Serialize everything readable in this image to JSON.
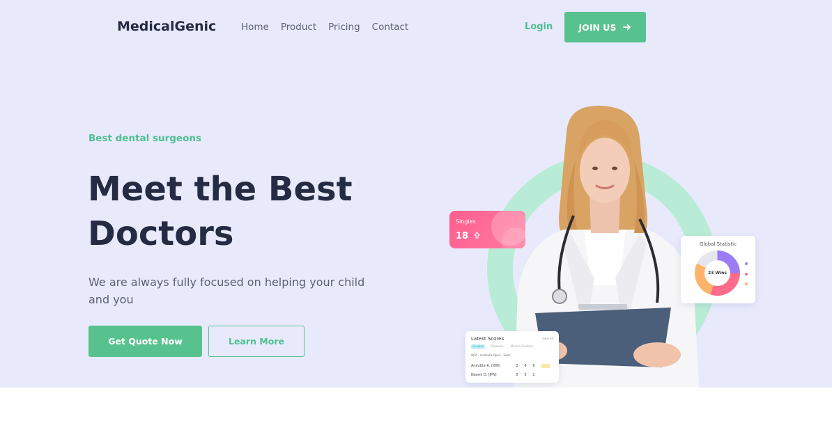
{
  "header": {
    "brand": "MedicalGenic",
    "nav": [
      "Home",
      "Product",
      "Pricing",
      "Contact"
    ],
    "login_label": "Login",
    "join_label": "JOIN US"
  },
  "hero": {
    "tagline": "Best dental surgeons",
    "headline_line1": "Meet the Best",
    "headline_line2": "Doctors",
    "subtext": "We are always fully focused on helping your child and you",
    "primary_cta": "Get Quote Now",
    "secondary_cta": "Learn More"
  },
  "cards": {
    "singles": {
      "label": "Singles",
      "value": "18"
    },
    "global_statistic": {
      "label": "Global Statistic",
      "center_value": "23 Wins",
      "center_sub": ""
    },
    "latest_scores": {
      "title": "Latest Scores",
      "view_all": "View All",
      "tabs": [
        "Singles",
        "Doubles",
        "Mixed Doubles"
      ],
      "match": "WTA - Australia Open - Semi",
      "rows": [
        {
          "name": "Anindita R. (IDN)",
          "s1": "2",
          "s2": "6",
          "s3": "6"
        },
        {
          "name": "Naomi O. (JPN)",
          "s1": "0",
          "s2": "3",
          "s3": "1"
        }
      ]
    }
  },
  "colors": {
    "accent": "#58c28f",
    "heading": "#252b42",
    "hero_bg": "#e8eafc",
    "singles_card": "#ff5f8f"
  }
}
